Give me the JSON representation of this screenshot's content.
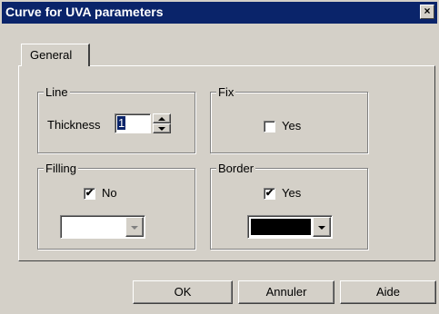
{
  "window": {
    "title": "Curve for UVA parameters",
    "close_glyph": "×"
  },
  "tabs": [
    {
      "label": "General"
    }
  ],
  "groups": {
    "line": {
      "label": "Line",
      "thickness_label": "Thickness",
      "thickness_value": "1"
    },
    "fix": {
      "label": "Fix",
      "checkbox_label": "Yes",
      "checked": false
    },
    "filling": {
      "label": "Filling",
      "checkbox_label": "No",
      "checked": true,
      "color_value": "#ffffff"
    },
    "border": {
      "label": "Border",
      "checkbox_label": "Yes",
      "checked": true,
      "color_value": "#000000"
    }
  },
  "check_glyph": "✔",
  "buttons": {
    "ok": "OK",
    "cancel": "Annuler",
    "help": "Aide"
  },
  "colors": {
    "title_bar": "#0a246a",
    "face": "#d4d0c8"
  }
}
